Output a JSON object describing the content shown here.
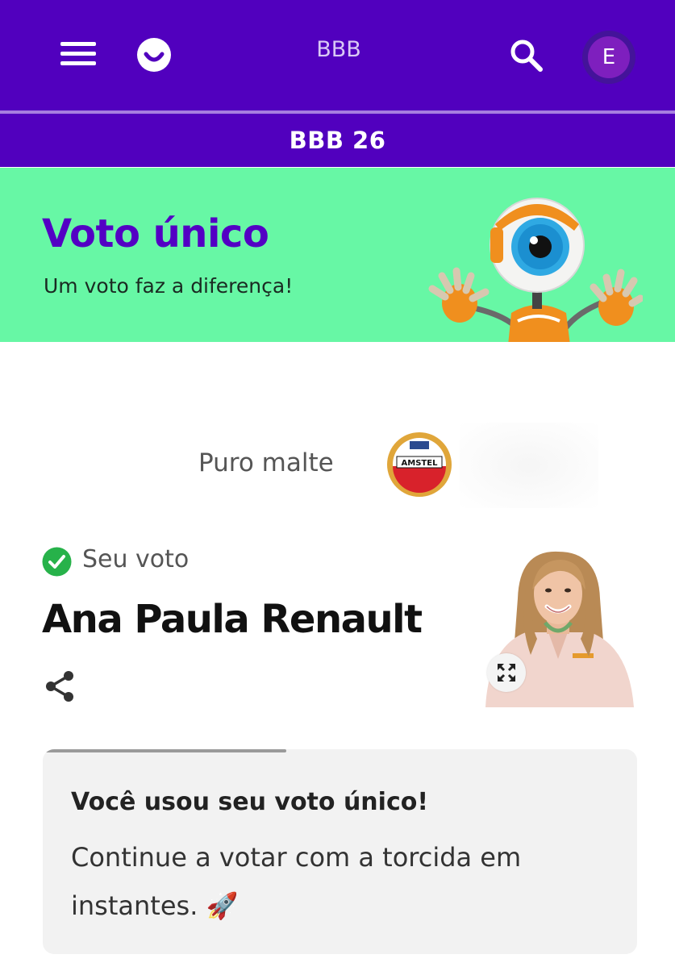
{
  "header": {
    "menu_icon": "hamburger-menu-icon",
    "logo_icon": "globoplay-smile-logo",
    "title": "BBB",
    "search_icon": "search-icon",
    "avatar_initial": "E",
    "colors": {
      "bar": "#5100be",
      "avatar_outer": "#44139a",
      "avatar_inner": "#7e1fbe"
    }
  },
  "subheader": {
    "title": "BBB 26"
  },
  "banner": {
    "title": "Voto único",
    "subtitle": "Um voto faz a diferença!",
    "mascot_icon": "big-brother-eye-mascot",
    "colors": {
      "background": "#67f7a5",
      "title": "#5300c4"
    }
  },
  "sponsor": {
    "text": "Puro malte",
    "logo_icon": "amstel-lager-logo",
    "logo_text": "AMSTEL"
  },
  "vote": {
    "check_icon": "check-circle-icon",
    "label": "Seu voto",
    "name": "Ana Paula Renault",
    "share_icon": "share-icon",
    "photo_icon": "candidate-photo",
    "expand_icon": "expand-icon"
  },
  "card": {
    "progress": 0.41,
    "title": "Você usou seu voto único!",
    "body": "Continue a votar com a torcida em instantes. 🚀"
  }
}
